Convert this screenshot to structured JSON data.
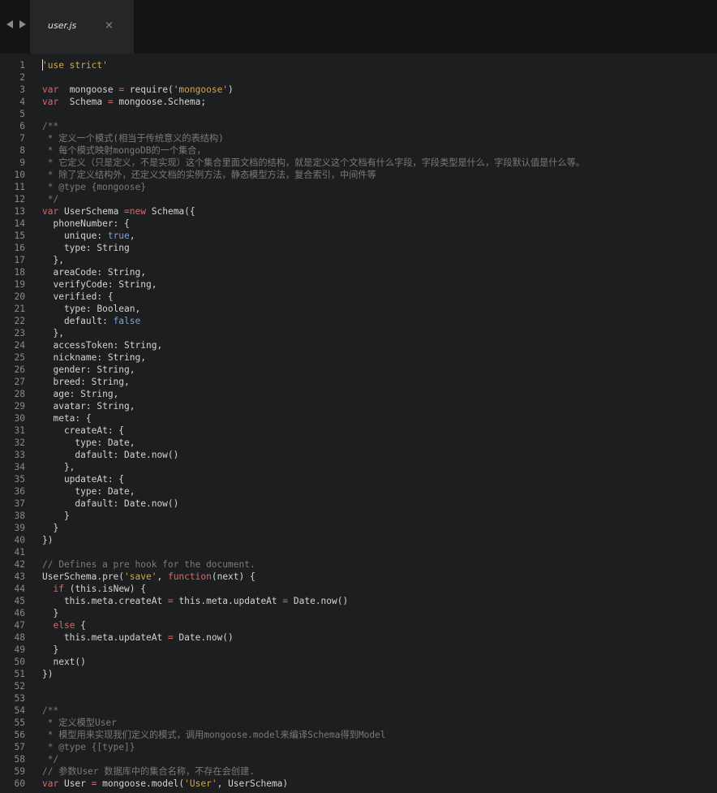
{
  "tab": {
    "title": "user.js"
  },
  "lines": [
    {
      "n": "1",
      "code": [
        [
          "str",
          "'use strict'"
        ]
      ]
    },
    {
      "n": "2",
      "code": []
    },
    {
      "n": "3",
      "code": [
        [
          "kw",
          "var"
        ],
        [
          "",
          "  mongoose "
        ],
        [
          "kw",
          "="
        ],
        [
          "",
          " require("
        ],
        [
          "str",
          "'mongoose'"
        ],
        [
          "",
          ")"
        ]
      ]
    },
    {
      "n": "4",
      "code": [
        [
          "kw",
          "var"
        ],
        [
          "",
          "  Schema "
        ],
        [
          "kw",
          "="
        ],
        [
          "",
          " mongoose.Schema;"
        ]
      ]
    },
    {
      "n": "5",
      "code": []
    },
    {
      "n": "6",
      "code": [
        [
          "cm",
          "/**"
        ]
      ]
    },
    {
      "n": "7",
      "code": [
        [
          "cm",
          " * 定义一个模式(相当于传统意义的表结构)"
        ]
      ]
    },
    {
      "n": "8",
      "code": [
        [
          "cm",
          " * 每个模式映射mongoDB的一个集合，"
        ]
      ]
    },
    {
      "n": "9",
      "code": [
        [
          "cm",
          " * 它定义（只是定义，不是实现）这个集合里面文档的结构，就是定义这个文档有什么字段，字段类型是什么，字段默认值是什么等。"
        ]
      ]
    },
    {
      "n": "10",
      "code": [
        [
          "cm",
          " * 除了定义结构外，还定义文档的实例方法，静态模型方法，复合索引，中间件等"
        ]
      ]
    },
    {
      "n": "11",
      "code": [
        [
          "cm",
          " * @type {mongoose}"
        ]
      ]
    },
    {
      "n": "12",
      "code": [
        [
          "cm",
          " */"
        ]
      ]
    },
    {
      "n": "13",
      "code": [
        [
          "kw",
          "var"
        ],
        [
          "",
          " UserSchema "
        ],
        [
          "kw",
          "="
        ],
        [
          " ",
          ""
        ],
        [
          "kw",
          "new"
        ],
        [
          "",
          " Schema({"
        ]
      ]
    },
    {
      "n": "14",
      "code": [
        [
          "",
          "  phoneNumber: {"
        ]
      ]
    },
    {
      "n": "15",
      "code": [
        [
          "",
          "    unique: "
        ],
        [
          "bool",
          "true"
        ],
        [
          "",
          ","
        ]
      ]
    },
    {
      "n": "16",
      "code": [
        [
          "",
          "    type: String"
        ]
      ]
    },
    {
      "n": "17",
      "code": [
        [
          "",
          "  },"
        ]
      ]
    },
    {
      "n": "18",
      "code": [
        [
          "",
          "  areaCode: String,"
        ]
      ]
    },
    {
      "n": "19",
      "code": [
        [
          "",
          "  verifyCode: String,"
        ]
      ]
    },
    {
      "n": "20",
      "code": [
        [
          "",
          "  verified: {"
        ]
      ]
    },
    {
      "n": "21",
      "code": [
        [
          "",
          "    type: Boolean,"
        ]
      ]
    },
    {
      "n": "22",
      "code": [
        [
          "",
          "    default: "
        ],
        [
          "bool",
          "false"
        ]
      ]
    },
    {
      "n": "23",
      "code": [
        [
          "",
          "  },"
        ]
      ]
    },
    {
      "n": "24",
      "code": [
        [
          "",
          "  accessToken: String,"
        ]
      ]
    },
    {
      "n": "25",
      "code": [
        [
          "",
          "  nickname: String,"
        ]
      ]
    },
    {
      "n": "26",
      "code": [
        [
          "",
          "  gender: String,"
        ]
      ]
    },
    {
      "n": "27",
      "code": [
        [
          "",
          "  breed: String,"
        ]
      ]
    },
    {
      "n": "28",
      "code": [
        [
          "",
          "  age: String,"
        ]
      ]
    },
    {
      "n": "29",
      "code": [
        [
          "",
          "  avatar: String,"
        ]
      ]
    },
    {
      "n": "30",
      "code": [
        [
          "",
          "  meta: {"
        ]
      ]
    },
    {
      "n": "31",
      "code": [
        [
          "",
          "    createAt: {"
        ]
      ]
    },
    {
      "n": "32",
      "code": [
        [
          "",
          "      type: Date,"
        ]
      ]
    },
    {
      "n": "33",
      "code": [
        [
          "",
          "      dafault: Date.now()"
        ]
      ]
    },
    {
      "n": "34",
      "code": [
        [
          "",
          "    },"
        ]
      ]
    },
    {
      "n": "35",
      "code": [
        [
          "",
          "    updateAt: {"
        ]
      ]
    },
    {
      "n": "36",
      "code": [
        [
          "",
          "      type: Date,"
        ]
      ]
    },
    {
      "n": "37",
      "code": [
        [
          "",
          "      dafault: Date.now()"
        ]
      ]
    },
    {
      "n": "38",
      "code": [
        [
          "",
          "    }"
        ]
      ]
    },
    {
      "n": "39",
      "code": [
        [
          "",
          "  }"
        ]
      ]
    },
    {
      "n": "40",
      "code": [
        [
          "",
          "})"
        ]
      ]
    },
    {
      "n": "41",
      "code": []
    },
    {
      "n": "42",
      "code": [
        [
          "cm",
          "// Defines a pre hook for the document."
        ]
      ]
    },
    {
      "n": "43",
      "code": [
        [
          "",
          "UserSchema.pre("
        ],
        [
          "str",
          "'save'"
        ],
        [
          "",
          ", "
        ],
        [
          "fn",
          "function"
        ],
        [
          "",
          "(next) {"
        ]
      ]
    },
    {
      "n": "44",
      "code": [
        [
          "",
          "  "
        ],
        [
          "kw",
          "if"
        ],
        [
          "",
          " (this.isNew) {"
        ]
      ]
    },
    {
      "n": "45",
      "code": [
        [
          "",
          "    this.meta.createAt "
        ],
        [
          "kw",
          "="
        ],
        [
          "",
          " this.meta.updateAt "
        ],
        [
          "kw",
          "="
        ],
        [
          "",
          " Date.now()"
        ]
      ]
    },
    {
      "n": "46",
      "code": [
        [
          "",
          "  }"
        ]
      ]
    },
    {
      "n": "47",
      "code": [
        [
          "",
          "  "
        ],
        [
          "kw",
          "else"
        ],
        [
          "",
          " {"
        ]
      ]
    },
    {
      "n": "48",
      "code": [
        [
          "",
          "    this.meta.updateAt "
        ],
        [
          "kw",
          "="
        ],
        [
          "",
          " Date.now()"
        ]
      ]
    },
    {
      "n": "49",
      "code": [
        [
          "",
          "  }"
        ]
      ]
    },
    {
      "n": "50",
      "code": [
        [
          "",
          "  next()"
        ]
      ]
    },
    {
      "n": "51",
      "code": [
        [
          "",
          "})"
        ]
      ]
    },
    {
      "n": "52",
      "code": []
    },
    {
      "n": "53",
      "code": []
    },
    {
      "n": "54",
      "code": [
        [
          "cm",
          "/**"
        ]
      ]
    },
    {
      "n": "55",
      "code": [
        [
          "cm",
          " * 定义模型User"
        ]
      ]
    },
    {
      "n": "56",
      "code": [
        [
          "cm",
          " * 模型用来实现我们定义的模式，调用mongoose.model来编译Schema得到Model"
        ]
      ]
    },
    {
      "n": "57",
      "code": [
        [
          "cm",
          " * @type {[type]}"
        ]
      ]
    },
    {
      "n": "58",
      "code": [
        [
          "cm",
          " */"
        ]
      ]
    },
    {
      "n": "59",
      "code": [
        [
          "cm",
          "// 参数User 数据库中的集合名称，不存在会创建."
        ]
      ]
    },
    {
      "n": "60",
      "code": [
        [
          "kw",
          "var"
        ],
        [
          "",
          " User "
        ],
        [
          "kw",
          "="
        ],
        [
          "",
          " mongoose.model("
        ],
        [
          "str",
          "'User'"
        ],
        [
          "",
          ", UserSchema)"
        ]
      ]
    }
  ]
}
